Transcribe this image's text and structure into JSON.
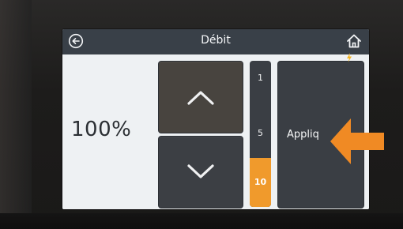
{
  "header": {
    "title": "Débit",
    "back_icon": "back-arrow-circle-icon",
    "home_icon": "home-icon"
  },
  "flow": {
    "value_label": "100%"
  },
  "controls": {
    "up_icon": "chevron-up-icon",
    "down_icon": "chevron-down-icon"
  },
  "step": {
    "options": [
      "1",
      "5",
      "10"
    ],
    "selected": "10"
  },
  "apply": {
    "label": "Appliq"
  },
  "colors": {
    "accent": "#f09a2c",
    "tile": "#3a3e44",
    "topbar": "#394048",
    "screen_bg": "#eef1f3"
  }
}
